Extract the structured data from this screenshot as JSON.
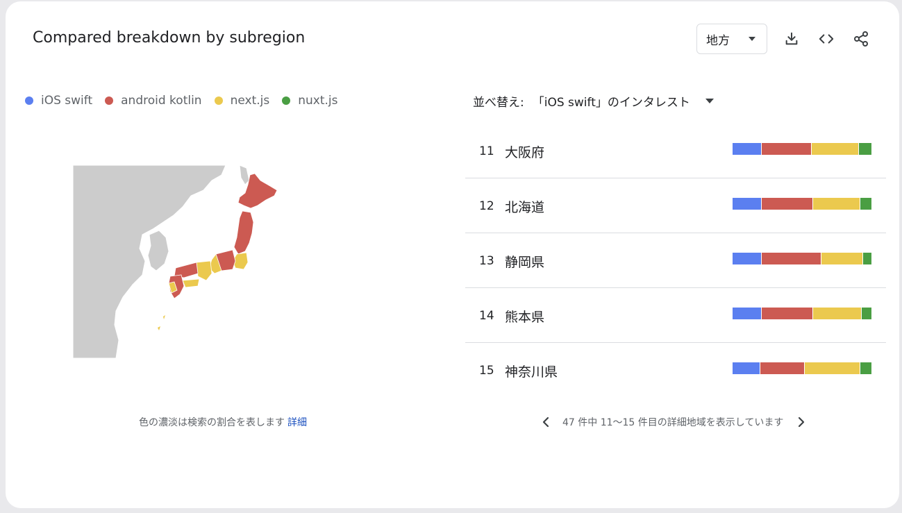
{
  "header": {
    "title": "Compared breakdown by subregion",
    "region_select": "地方"
  },
  "toolbar": {
    "download_icon": "download-icon",
    "embed_icon": "code-icon",
    "share_icon": "share-icon"
  },
  "colors": {
    "ios": "#5b7ff0",
    "android": "#cc5a52",
    "next": "#ebc94e",
    "nuxt": "#4a9e43",
    "land": "#cccccc"
  },
  "legend": [
    {
      "label": "iOS swift",
      "color": "#5b7ff0"
    },
    {
      "label": "android kotlin",
      "color": "#cc5a52"
    },
    {
      "label": "next.js",
      "color": "#ebc94e"
    },
    {
      "label": "nuxt.js",
      "color": "#4a9e43"
    }
  ],
  "map": {
    "note": "色の濃淡は検索の割合を表します",
    "details_link": "詳細"
  },
  "sort": {
    "label": "並べ替え:",
    "value": "「iOS swift」のインタレスト"
  },
  "rows": [
    {
      "rank": "11",
      "name": "大阪府",
      "shares": [
        21,
        36,
        34,
        9
      ]
    },
    {
      "rank": "12",
      "name": "北海道",
      "shares": [
        21,
        37,
        34,
        8
      ]
    },
    {
      "rank": "13",
      "name": "静岡県",
      "shares": [
        21,
        43,
        30,
        6
      ]
    },
    {
      "rank": "14",
      "name": "熊本県",
      "shares": [
        21,
        37,
        35,
        7
      ]
    },
    {
      "rank": "15",
      "name": "神奈川県",
      "shares": [
        20,
        32,
        40,
        8
      ]
    }
  ],
  "pager": {
    "text": "47 件中 11〜15 件目の詳細地域を表示しています"
  }
}
